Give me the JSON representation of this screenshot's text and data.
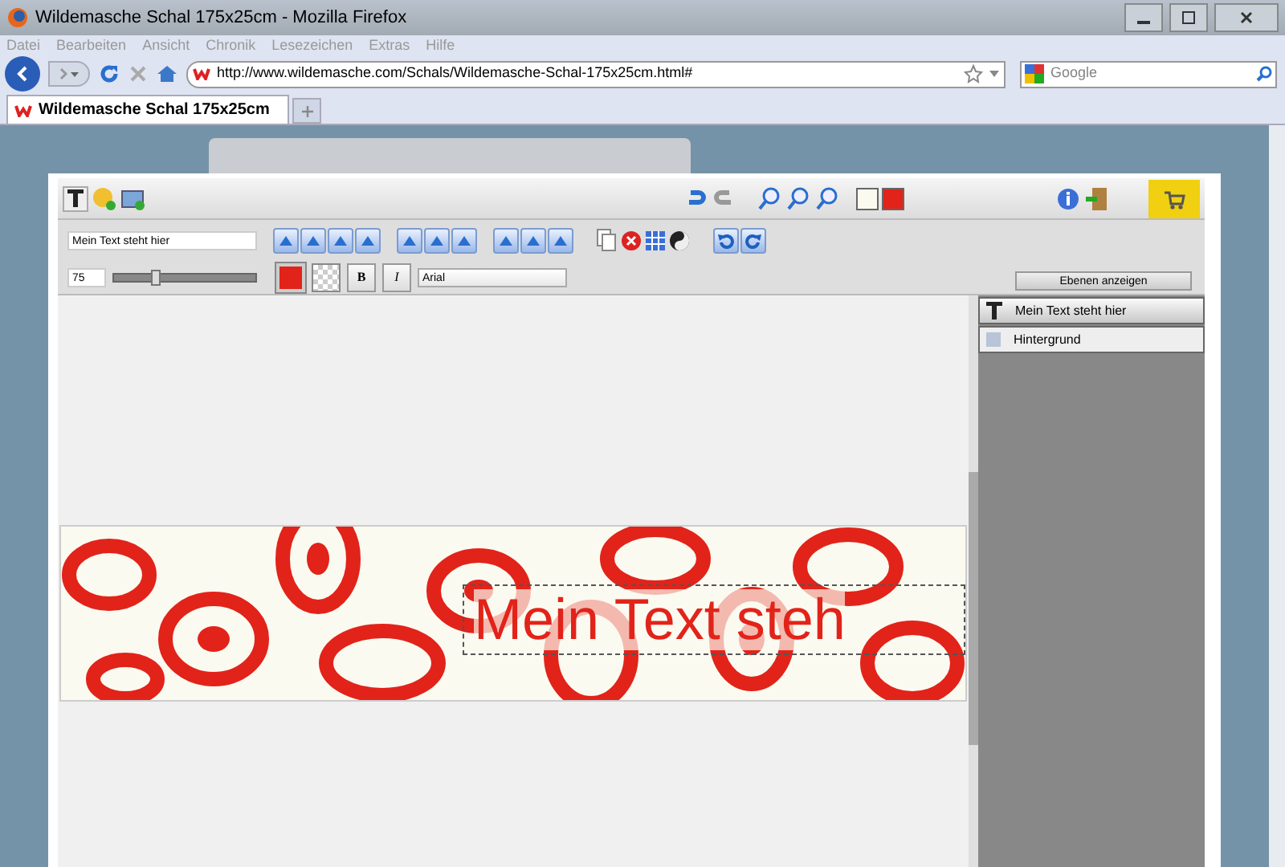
{
  "window": {
    "title": "Wildemasche Schal 175x25cm - Mozilla Firefox"
  },
  "menu": [
    "Datei",
    "Bearbeiten",
    "Ansicht",
    "Chronik",
    "Lesezeichen",
    "Extras",
    "Hilfe"
  ],
  "address_bar": {
    "url": "http://www.wildemasche.com/Schals/Wildemasche-Schal-175x25cm.html#"
  },
  "search": {
    "placeholder": "Google"
  },
  "tabs": [
    {
      "label": "Wildemasche Schal 175x25cm",
      "selected": true
    }
  ],
  "editor": {
    "text_field": {
      "value": "Mein Text steht hier"
    },
    "size_field": {
      "value": "75"
    },
    "size_slider": {
      "level": 0.27
    },
    "bold_button": "B",
    "italic_button": "I",
    "font_field": {
      "value": "Arial"
    },
    "layers_button": "Ebenen anzeigen",
    "layers": [
      {
        "label": "Mein Text steht hier",
        "kind": "text",
        "selected": true
      },
      {
        "label": "Hintergrund",
        "kind": "background",
        "selected": false
      }
    ],
    "canvas_text": "Mein Text steh"
  }
}
